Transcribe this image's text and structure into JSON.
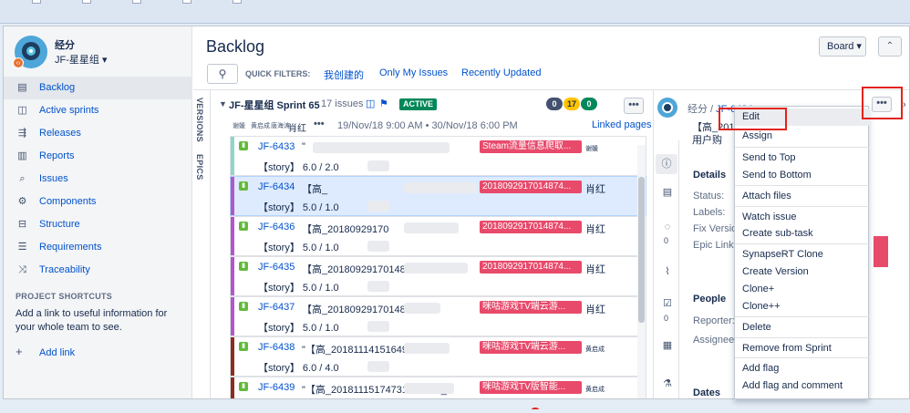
{
  "project": {
    "name": "经分",
    "board_name": "JF-星星组 ▾"
  },
  "sidebar": {
    "items": [
      {
        "label": "Backlog",
        "icon": "backlog-icon",
        "glyph": "▤"
      },
      {
        "label": "Active sprints",
        "icon": "active-sprints-icon",
        "glyph": "◫"
      },
      {
        "label": "Releases",
        "icon": "releases-icon",
        "glyph": "⇶"
      },
      {
        "label": "Reports",
        "icon": "reports-icon",
        "glyph": "▥"
      },
      {
        "label": "Issues",
        "icon": "issues-icon",
        "glyph": "⌕"
      },
      {
        "label": "Components",
        "icon": "components-icon",
        "glyph": "⚙"
      },
      {
        "label": "Structure",
        "icon": "structure-icon",
        "glyph": "⊟"
      },
      {
        "label": "Requirements",
        "icon": "requirements-icon",
        "glyph": "☰"
      },
      {
        "label": "Traceability",
        "icon": "traceability-icon",
        "glyph": "⤨"
      }
    ],
    "shortcuts_title": "PROJECT SHORTCUTS",
    "shortcuts_text": "Add a link to useful information for your whole team to see.",
    "add_link": "Add link"
  },
  "header": {
    "title": "Backlog",
    "board_button": "Board ▾",
    "collapse_glyph": "⌃",
    "quick_filters_label": "QUICK FILTERS:",
    "quick_filters": [
      "我创建的",
      "Only My Issues",
      "Recently Updated"
    ]
  },
  "vertical_tabs": [
    "VERSIONS",
    "EPICS"
  ],
  "sprint": {
    "name": "JF-星星组 Sprint 65",
    "issue_count": "17 issues",
    "status": "ACTIVE",
    "counts": [
      "0",
      "17",
      "0"
    ],
    "tags": [
      "谢媛",
      "黄启成",
      "唐海涛",
      "肖红"
    ],
    "dates": "19/Nov/18 9:00 AM • 30/Nov/18 6:00 PM",
    "linked_pages": "Linked pages",
    "more": "•••",
    "tag_more": "•••"
  },
  "issues": [
    {
      "key": "JF-6433",
      "summary": "\"",
      "story": "【story】 6.0 / 2.0",
      "epic": "Steam流量信息爬取...",
      "assignee": "谢媛",
      "small": true,
      "bar": "#8fd7c6",
      "selected": false
    },
    {
      "key": "JF-6434",
      "summary": "【高_",
      "story": "【story】 5.0 / 1.0",
      "epic": "2018092917014874...",
      "assignee": "肖红",
      "small": false,
      "bar": "#b158c9",
      "selected": true
    },
    {
      "key": "JF-6436",
      "summary": "【高_20180929170",
      "story": "【story】 5.0 / 1.0",
      "epic": "2018092917014874...",
      "assignee": "肖红",
      "small": false,
      "bar": "#b158c9",
      "selected": false
    },
    {
      "key": "JF-6435",
      "summary": "【高_2018092917014874",
      "story": "【story】 5.0 / 1.0",
      "epic": "2018092917014874...",
      "assignee": "肖红",
      "small": false,
      "bar": "#b158c9",
      "selected": false
    },
    {
      "key": "JF-6437",
      "summary": "【高_20180929170148744569",
      "story": "【story】 5.0 / 1.0",
      "epic": "咪咕游戏TV端云游...",
      "assignee": "肖红",
      "small": false,
      "bar": "#b158c9",
      "selected": false
    },
    {
      "key": "JF-6438",
      "summary": "\"【高_20181114151649947972",
      "story": "【story】 6.0 / 4.0",
      "epic": "咪咕游戏TV端云游...",
      "assignee": "黄启成",
      "small": true,
      "bar": "#8b2e1f",
      "selected": false
    },
    {
      "key": "JF-6439",
      "summary": "\"【高_20181115174731989069_",
      "story": "【story】",
      "epic": "咪咕游戏TV版智能...",
      "assignee": "黄启成",
      "small": true,
      "bar": "#8b2e1f",
      "selected": false
    }
  ],
  "detail": {
    "crumb_project": "经分",
    "crumb_key": "JF-6434",
    "title_lines": [
      "【高_20180",
      "",
      "用户购"
    ],
    "sections": {
      "details": "Details",
      "people": "People",
      "dates": "Dates"
    },
    "fields": [
      "Status:",
      "Labels:",
      "Fix Version",
      "Epic Link:",
      "Reporter:",
      "Assignee:"
    ],
    "rail_counts": [
      "0",
      "0"
    ],
    "more": "•••",
    "chevron": "›"
  },
  "context_menu": {
    "items": [
      "Edit",
      "Assign",
      "Send to Top",
      "Send to Bottom",
      "Attach files",
      "Watch issue",
      "Create sub-task",
      "SynapseRT Clone",
      "Create Version",
      "Clone+",
      "Clone++",
      "Delete",
      "Remove from Sprint",
      "Add flag",
      "Add flag and comment"
    ]
  },
  "colors": {
    "accent": "#0052cc",
    "active": "#00875a",
    "epic": "#e84a6b",
    "highlight": "#e2231a"
  }
}
